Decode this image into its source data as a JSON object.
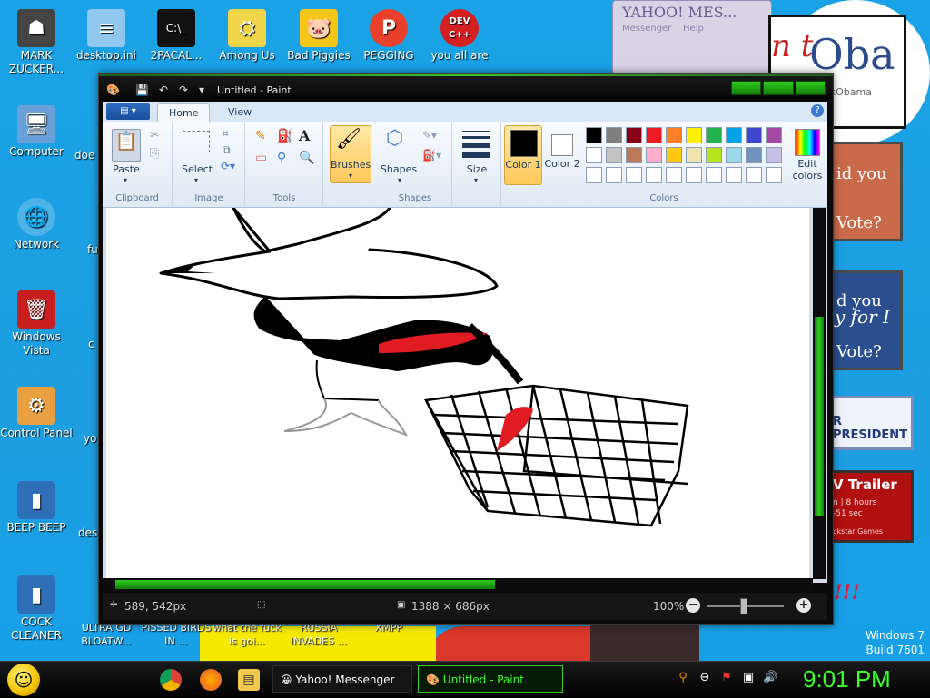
{
  "desktop": {
    "icons_top": [
      {
        "label": "MARK ZUCKER...",
        "icon": "person-icon"
      },
      {
        "label": "desktop.ini",
        "icon": "ini-file-icon"
      },
      {
        "label": "2PACAL...",
        "icon": "console-icon"
      },
      {
        "label": "Among Us",
        "icon": "among-us-icon"
      },
      {
        "label": "Bad Piggies",
        "icon": "bad-piggies-icon"
      },
      {
        "label": "PEGGING",
        "icon": "pegging-icon"
      },
      {
        "label": "you all are",
        "icon": "devcpp-icon"
      }
    ],
    "icons_left": [
      {
        "label": "Computer",
        "icon": "computer-icon"
      },
      {
        "label": "Network",
        "icon": "network-icon"
      },
      {
        "label": "Windows Vista",
        "icon": "recycle-bin-icon"
      },
      {
        "label": "Control Panel",
        "icon": "control-panel-icon"
      },
      {
        "label": "BEEP BEEP",
        "icon": "file-icon"
      },
      {
        "label": "COCK CLEANER",
        "icon": "file-icon"
      }
    ],
    "truncated_labels": [
      "doe",
      "fu",
      "c",
      "yo",
      "des"
    ],
    "bottom_row": [
      {
        "label": "ULTRA GD BLOATW..."
      },
      {
        "label": "PISSED BIRDS IN ..."
      },
      {
        "label": "what the fuck is goi..."
      },
      {
        "label": "RUSSIA INVADES ..."
      },
      {
        "label": "XMPP"
      }
    ],
    "devcpp_badge": "DEV C++",
    "watermark": {
      "line1": "Windows 7",
      "line2": "Build 7601"
    },
    "accent_color": "#3cc72a"
  },
  "yahoo_window": {
    "logo": "YAHOO! MES...",
    "menu": [
      "Messenger",
      "Help"
    ]
  },
  "posters": {
    "obama_text": "Oba",
    "obama_small": "ackObama",
    "fragment": "n t",
    "did_you_1": "id you",
    "vote_1": "Vote?",
    "did_you_2": "d you",
    "for_1": "y for I",
    "vote_2": "Vote?",
    "president": "R PRESIDENT",
    "trailer_title": "V Trailer",
    "trailer_line1": "n | 8 hours",
    "trailer_line2": "-51 sec",
    "trailer_line3": "ckstar Games",
    "exclaim": "!!!"
  },
  "paint": {
    "title": "Untitled - Paint",
    "tabs": [
      {
        "label": "Home",
        "active": true
      },
      {
        "label": "View",
        "active": false
      }
    ],
    "groups": {
      "clipboard": {
        "label": "Clipboard",
        "paste": "Paste"
      },
      "image": {
        "label": "Image",
        "select": "Select"
      },
      "tools": {
        "label": "Tools"
      },
      "brushes": {
        "label": "Brushes"
      },
      "shapes": {
        "label": "Shapes",
        "shapes_btn": "Shapes"
      },
      "size": {
        "label": "Size"
      },
      "colors": {
        "label": "Colors",
        "color1": "Color 1",
        "color2": "Color 2",
        "edit_colors": "Edit colors"
      }
    },
    "color1": "#000000",
    "color2": "#ffffff",
    "palette_row1": [
      "#000000",
      "#7f7f7f",
      "#880015",
      "#ed1c24",
      "#ff7f27",
      "#fff200",
      "#22b14c",
      "#00a2e8",
      "#3f48cc",
      "#a349a4"
    ],
    "palette_row2": [
      "#ffffff",
      "#c3c3c3",
      "#b97a57",
      "#ffaec9",
      "#ffc90e",
      "#efe4b0",
      "#b5e61d",
      "#99d9ea",
      "#7092be",
      "#c8bfe7"
    ],
    "palette_row3": [
      "#ffffff",
      "#ffffff",
      "#ffffff",
      "#ffffff",
      "#ffffff",
      "#ffffff",
      "#ffffff",
      "#ffffff",
      "#ffffff",
      "#ffffff"
    ],
    "status": {
      "cursor_pos": "589, 542px",
      "canvas_size": "1388 × 686px",
      "zoom": "100%"
    }
  },
  "taskbar": {
    "buttons": [
      {
        "label": "Yahoo! Messenger",
        "icon": "yahoo-icon"
      },
      {
        "label": "Untitled - Paint",
        "icon": "paint-icon"
      }
    ],
    "clock": "9:01 PM"
  }
}
